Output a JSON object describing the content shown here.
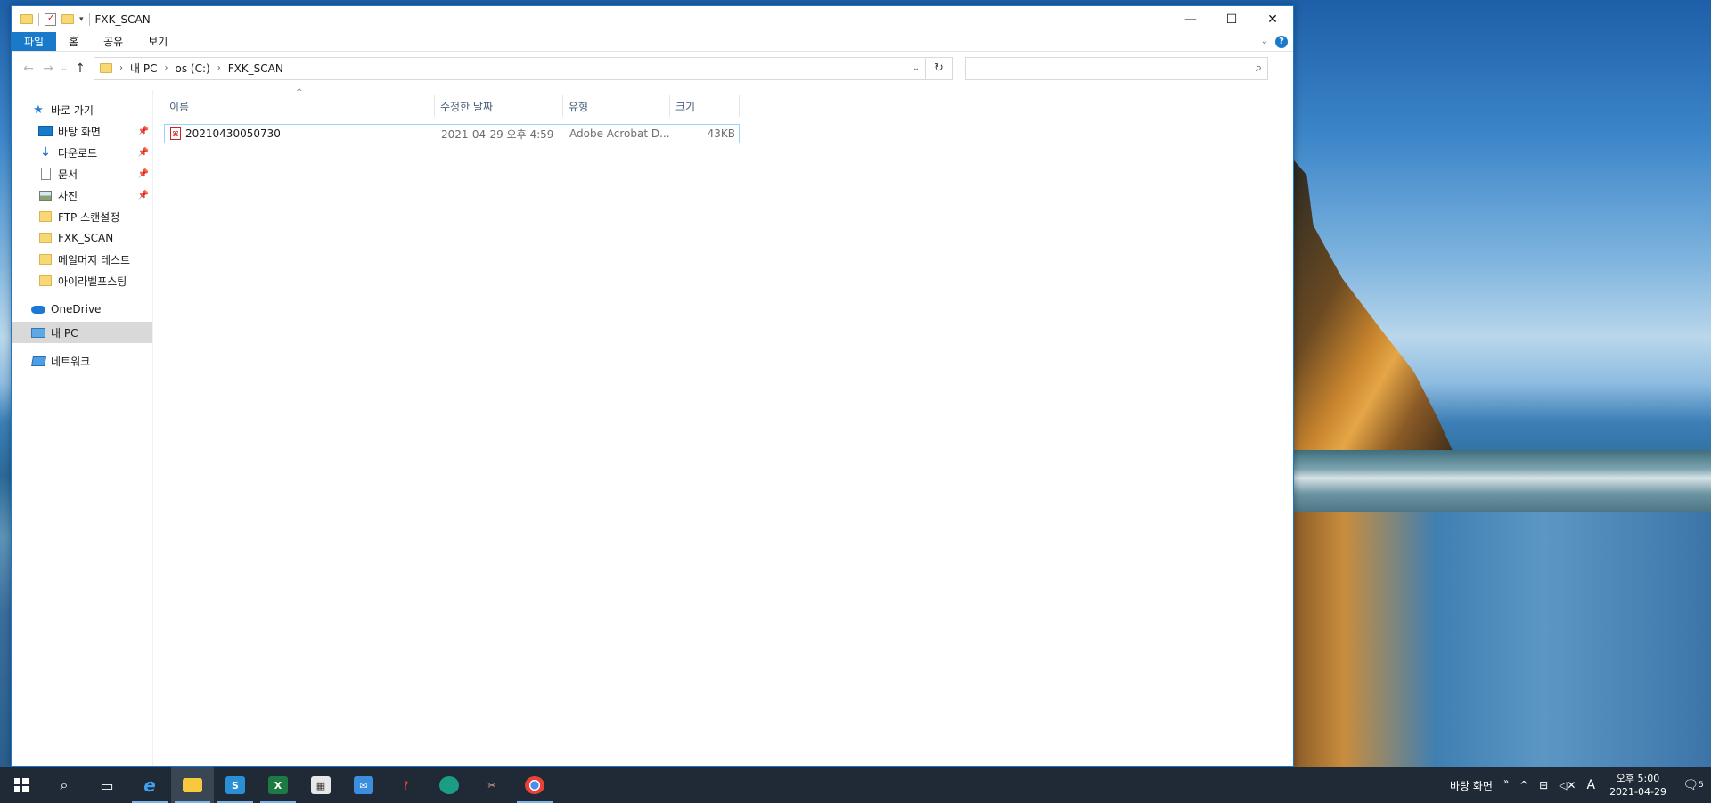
{
  "window": {
    "title": "FXK_SCAN",
    "minimize_glyph": "—",
    "maximize_glyph": "☐",
    "close_glyph": "✕"
  },
  "ribbon": {
    "tabs": [
      "파일",
      "홈",
      "공유",
      "보기"
    ],
    "help_glyph": "?",
    "expand_glyph": "⌄"
  },
  "address": {
    "back_glyph": "←",
    "forward_glyph": "→",
    "recent_glyph": "⌄",
    "up_glyph": "↑",
    "crumbs": [
      "내 PC",
      "os (C:)",
      "FXK_SCAN"
    ],
    "crumb_sep": "›",
    "dropdown_glyph": "⌄",
    "refresh_glyph": "↻",
    "search_placeholder": "",
    "search_glyph": "⌕"
  },
  "nav": {
    "quick_access": "바로 가기",
    "quick_items": [
      {
        "label": "바탕 화면",
        "icon": "desktop-icon",
        "pinned": true
      },
      {
        "label": "다운로드",
        "icon": "download-icon",
        "pinned": true
      },
      {
        "label": "문서",
        "icon": "document-icon",
        "pinned": true
      },
      {
        "label": "사진",
        "icon": "pictures-icon",
        "pinned": true
      },
      {
        "label": "FTP 스캔설정",
        "icon": "folder-icon",
        "pinned": false
      },
      {
        "label": "FXK_SCAN",
        "icon": "folder-icon",
        "pinned": false
      },
      {
        "label": "메일머지 테스트",
        "icon": "folder-icon",
        "pinned": false
      },
      {
        "label": "아이라벨포스팅",
        "icon": "folder-icon",
        "pinned": false
      }
    ],
    "pin_glyph": "📌",
    "onedrive": "OneDrive",
    "this_pc": "내 PC",
    "network": "네트워크"
  },
  "columns": {
    "name": "이름",
    "modified": "수정한 날짜",
    "type": "유형",
    "size": "크기",
    "sort_glyph": "^"
  },
  "files": [
    {
      "name": "20210430050730",
      "modified": "2021-04-29 오후 4:59",
      "type": "Adobe Acrobat D...",
      "size": "43KB",
      "icon": "pdf-icon"
    }
  ],
  "taskbar": {
    "apps": [
      "start-icon",
      "search-icon",
      "task-view-icon",
      "internet-explorer-icon",
      "file-explorer-icon",
      "outlook-app-icon",
      "excel-icon",
      "store-icon",
      "mail-icon",
      "app-red-icon",
      "edge-icon",
      "snipping-icon",
      "chrome-icon"
    ],
    "tray_desktop": "바탕 화면",
    "tray_chevron": "»",
    "tray_up": "^",
    "ime": "A",
    "time": "오후 5:00",
    "date": "2021-04-29",
    "notifications": "5"
  },
  "colors": {
    "accent": "#1979ca",
    "taskbar": "#1f2a36",
    "selection_border": "#99d1ff"
  }
}
